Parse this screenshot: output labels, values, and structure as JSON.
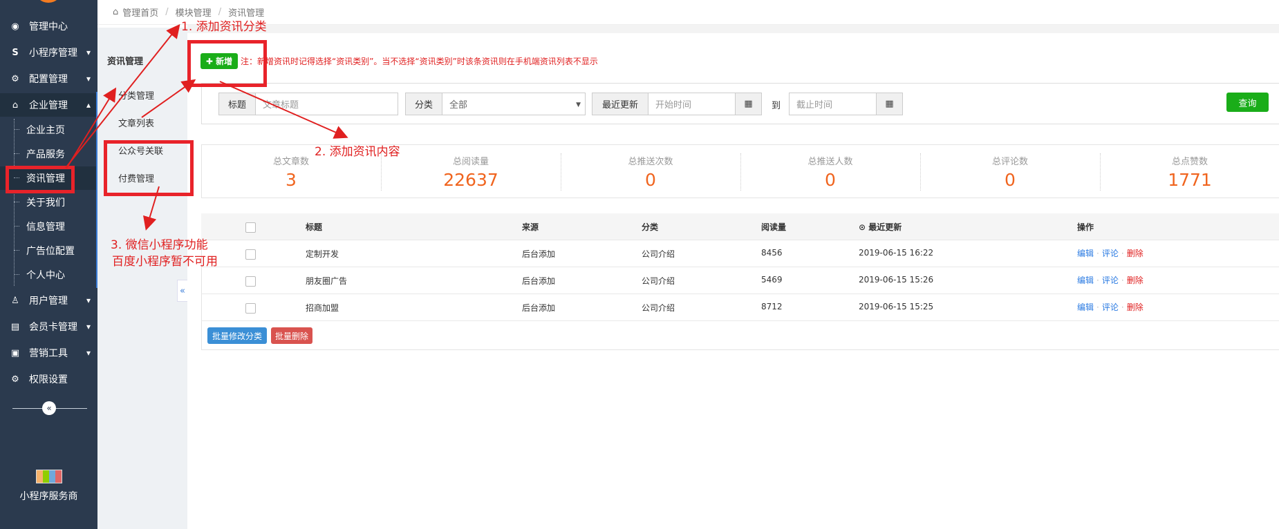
{
  "sidebar": {
    "items": [
      {
        "label": "管理中心",
        "icon": "dashboard-icon",
        "glyph": "◉"
      },
      {
        "label": "小程序管理",
        "icon": "miniprogram-icon",
        "glyph": "S"
      },
      {
        "label": "配置管理",
        "icon": "gears-icon",
        "glyph": "⚙"
      },
      {
        "label": "企业管理",
        "icon": "bank-icon",
        "glyph": "⌂"
      }
    ],
    "sub_items": [
      "企业主页",
      "产品服务",
      "资讯管理",
      "关于我们",
      "信息管理",
      "广告位配置",
      "个人中心"
    ],
    "bottom_items": [
      {
        "label": "用户管理",
        "icon": "user-icon",
        "glyph": "♙"
      },
      {
        "label": "会员卡管理",
        "icon": "card-icon",
        "glyph": "▤"
      },
      {
        "label": "营销工具",
        "icon": "briefcase-icon",
        "glyph": "▣"
      },
      {
        "label": "权限设置",
        "icon": "cog-icon",
        "glyph": "⚙"
      }
    ],
    "collapse_glyph": "«",
    "provider_label": "小程序服务商"
  },
  "breadcrumb": [
    "管理首页",
    "模块管理",
    "资讯管理"
  ],
  "submenu": {
    "title": "资讯管理",
    "items": [
      "分类管理",
      "文章列表",
      "公众号关联",
      "付费管理"
    ],
    "collapse_glyph": "«"
  },
  "toolbar": {
    "add_label": "✚ 新增",
    "note": "注：新增资讯时记得选择“资讯类别”。当不选择“资讯类别”时该条资讯则在手机端资讯列表不显示"
  },
  "filters": {
    "title_label": "标题",
    "title_placeholder": "文章标题",
    "category_label": "分类",
    "category_value": "全部",
    "updated_label": "最近更新",
    "start_placeholder": "开始时间",
    "to_label": "到",
    "end_placeholder": "截止时间",
    "query_label": "查询"
  },
  "stats": [
    {
      "label": "总文章数",
      "value": "3"
    },
    {
      "label": "总阅读量",
      "value": "22637"
    },
    {
      "label": "总推送次数",
      "value": "0"
    },
    {
      "label": "总推送人数",
      "value": "0"
    },
    {
      "label": "总评论数",
      "value": "0"
    },
    {
      "label": "总点赞数",
      "value": "1771"
    }
  ],
  "table": {
    "headers": [
      "标题",
      "来源",
      "分类",
      "阅读量",
      "最近更新",
      "操作"
    ],
    "rows": [
      {
        "title": "定制开发",
        "source": "后台添加",
        "category": "公司介绍",
        "reads": "8456",
        "updated": "2019-06-15 16:22"
      },
      {
        "title": "朋友圈广告",
        "source": "后台添加",
        "category": "公司介绍",
        "reads": "5469",
        "updated": "2019-06-15 15:26"
      },
      {
        "title": "招商加盟",
        "source": "后台添加",
        "category": "公司介绍",
        "reads": "8712",
        "updated": "2019-06-15 15:25"
      }
    ],
    "ops": {
      "edit": "编辑",
      "comment": "评论",
      "delete": "删除"
    },
    "batch_edit": "批量修改分类",
    "batch_delete": "批量删除"
  },
  "annotations": {
    "a1": "1.  添加资讯分类",
    "a2": "2.  添加资讯内容",
    "a3_line1": "3.  微信小程序功能",
    "a3_line2": "百度小程序暂不可用",
    "color": "#e02020"
  }
}
